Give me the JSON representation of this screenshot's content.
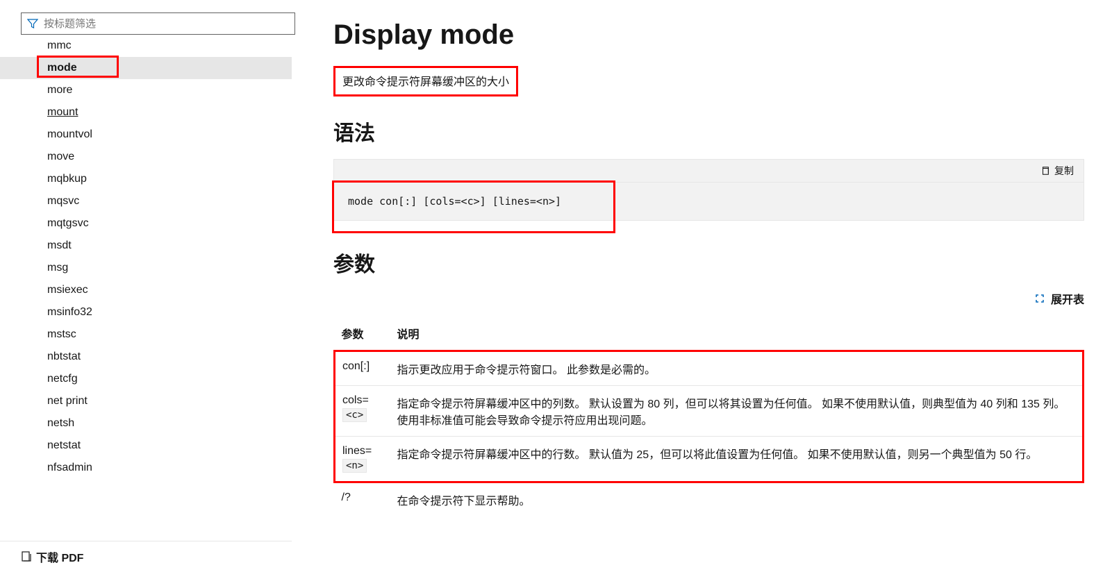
{
  "filter": {
    "placeholder": "按标题筛选"
  },
  "nav": {
    "items": [
      {
        "label": "mmc",
        "active": false,
        "underlined": false
      },
      {
        "label": "mode",
        "active": true,
        "underlined": false
      },
      {
        "label": "more",
        "active": false,
        "underlined": false
      },
      {
        "label": "mount",
        "active": false,
        "underlined": true
      },
      {
        "label": "mountvol",
        "active": false,
        "underlined": false
      },
      {
        "label": "move",
        "active": false,
        "underlined": false
      },
      {
        "label": "mqbkup",
        "active": false,
        "underlined": false
      },
      {
        "label": "mqsvc",
        "active": false,
        "underlined": false
      },
      {
        "label": "mqtgsvc",
        "active": false,
        "underlined": false
      },
      {
        "label": "msdt",
        "active": false,
        "underlined": false
      },
      {
        "label": "msg",
        "active": false,
        "underlined": false
      },
      {
        "label": "msiexec",
        "active": false,
        "underlined": false
      },
      {
        "label": "msinfo32",
        "active": false,
        "underlined": false
      },
      {
        "label": "mstsc",
        "active": false,
        "underlined": false
      },
      {
        "label": "nbtstat",
        "active": false,
        "underlined": false
      },
      {
        "label": "netcfg",
        "active": false,
        "underlined": false
      },
      {
        "label": "net print",
        "active": false,
        "underlined": false
      },
      {
        "label": "netsh",
        "active": false,
        "underlined": false
      },
      {
        "label": "netstat",
        "active": false,
        "underlined": false
      },
      {
        "label": "nfsadmin",
        "active": false,
        "underlined": false
      }
    ]
  },
  "footer": {
    "download": "下载 PDF"
  },
  "main": {
    "title": "Display mode",
    "description": "更改命令提示符屏幕缓冲区的大小",
    "syntax_heading": "语法",
    "syntax_code": "mode con[:] [cols=<c>] [lines=<n>]",
    "copy_label": "复制",
    "params_heading": "参数",
    "expand_label": "展开表",
    "table": {
      "header": {
        "param": "参数",
        "desc": "说明"
      },
      "rows": [
        {
          "param": "con[:]",
          "code": "",
          "desc": "指示更改应用于命令提示符窗口。 此参数是必需的。"
        },
        {
          "param": "cols=",
          "code": "<c>",
          "desc": "指定命令提示符屏幕缓冲区中的列数。 默认设置为 80 列，但可以将其设置为任何值。 如果不使用默认值，则典型值为 40 列和 135 列。 使用非标准值可能会导致命令提示符应用出现问题。"
        },
        {
          "param": "lines=",
          "code": "<n>",
          "desc": "指定命令提示符屏幕缓冲区中的行数。 默认值为 25，但可以将此值设置为任何值。 如果不使用默认值，则另一个典型值为 50 行。"
        },
        {
          "param": "/?",
          "code": "",
          "desc": "在命令提示符下显示帮助。"
        }
      ]
    }
  }
}
